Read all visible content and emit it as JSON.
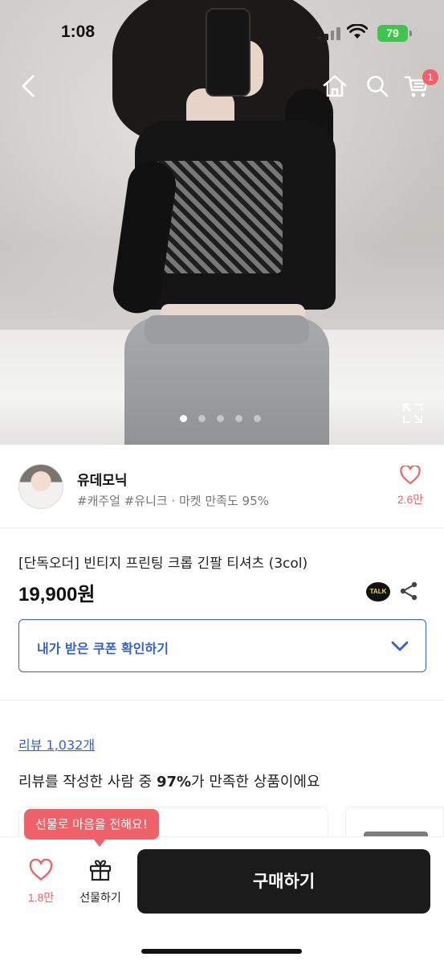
{
  "status_bar": {
    "time": "1:08",
    "battery": "79"
  },
  "header": {
    "cart_badge": "1",
    "image_pages": 5,
    "active_page": 1
  },
  "seller": {
    "name": "유데모닉",
    "tags": "#캐주얼 #유니크 · 마켓 만족도 95%",
    "likes": "2.6만"
  },
  "product": {
    "title": "[단독오더] 빈티지 프린팅 크롭 긴팔 티셔츠 (3col)",
    "price": "19,900원",
    "talk_label": "TALK"
  },
  "coupon": {
    "label": "내가 받은 쿠폰 확인하기"
  },
  "reviews": {
    "link": "리뷰 1,032개",
    "summary_prefix": "리뷰를 작성한 사람 중 ",
    "summary_percent": "97%",
    "summary_suffix": "가 만족한 상품이에요"
  },
  "bottom_bar": {
    "tooltip": "선물로 마음을 전해요!",
    "wish_count": "1.8만",
    "gift_label": "선물하기",
    "buy_label": "구매하기"
  },
  "colors": {
    "accent_pink": "#f06269",
    "link_blue": "#3461c9",
    "buy_button": "#1b1b1b",
    "battery": "#3fc54b"
  }
}
